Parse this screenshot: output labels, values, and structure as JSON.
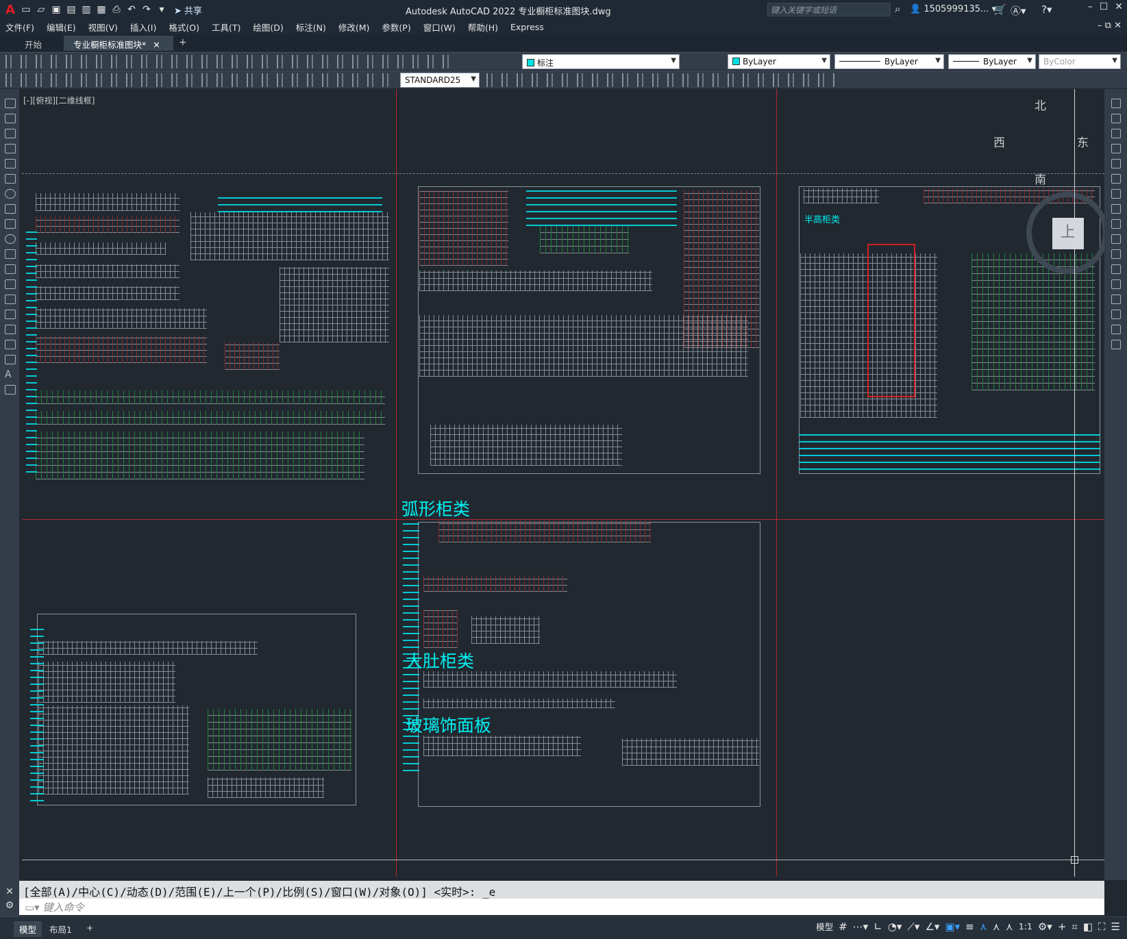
{
  "titlebar": {
    "logo": "A",
    "share_label": "共享",
    "window_title": "Autodesk AutoCAD 2022    专业橱柜标准图块.dwg",
    "search_placeholder": "键入关键字或短语",
    "user": "1505999135...",
    "minimize": "–",
    "maximize": "☐",
    "close": "✕"
  },
  "menu": {
    "items": [
      "文件(F)",
      "编辑(E)",
      "视图(V)",
      "插入(I)",
      "格式(O)",
      "工具(T)",
      "绘图(D)",
      "标注(N)",
      "修改(M)",
      "参数(P)",
      "窗口(W)",
      "帮助(H)",
      "Express"
    ],
    "controls": "– ⧉ ✕"
  },
  "tabs": {
    "start": "开始",
    "active": "专业橱柜标准图块*",
    "close": "✕",
    "add": "+"
  },
  "toolbar1": {
    "layer": "标注",
    "color": "ByLayer",
    "linetype": "ByLayer",
    "lineweight": "ByLayer",
    "plotstyle": "ByColor"
  },
  "toolbar2": {
    "dimstyle": "STANDARD25"
  },
  "viewport": {
    "label": "[-][俯视][二维线框]",
    "sections": [
      "弧形柜类",
      "大肚柜类",
      "玻璃饰面板",
      "半高柜类"
    ]
  },
  "viewcube": {
    "north": "北",
    "south": "南",
    "east": "东",
    "west": "西",
    "top": "上"
  },
  "command": {
    "history": "[全部(A)/中心(C)/动态(D)/范围(E)/上一个(P)/比例(S)/窗口(W)/对象(O)] <实时>: _e",
    "placeholder": "键入命令"
  },
  "status": {
    "model_tab": "模型",
    "layout_tab": "布局1",
    "add": "+",
    "model_label": "模型",
    "scale": "1:1"
  },
  "colors": {
    "background": "#212830",
    "cyan": "#00f0f0",
    "red": "#b3262a"
  }
}
